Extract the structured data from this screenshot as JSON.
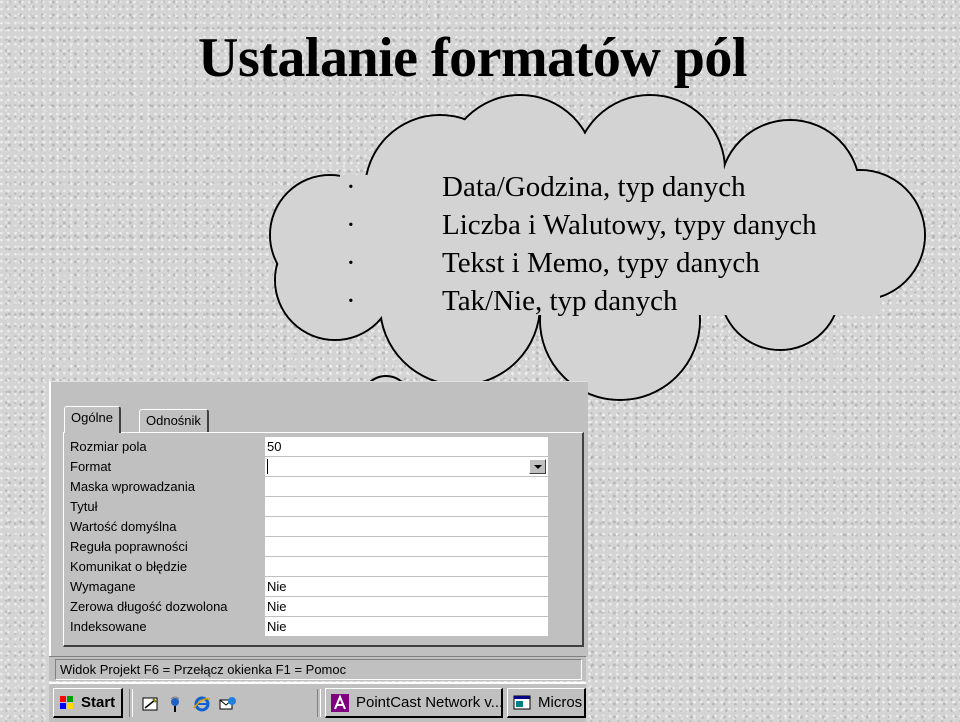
{
  "slide": {
    "title": "Ustalanie formatów pól"
  },
  "cloud": {
    "bullet": "·",
    "items": [
      "Data/Godzina, typ danych",
      "Liczba i Walutowy, typy danych",
      "Tekst i Memo, typy danych",
      "Tak/Nie, typ danych"
    ]
  },
  "properties": {
    "tabs": [
      "Ogólne",
      "Odnośnik"
    ],
    "rows": [
      {
        "label": "Rozmiar pola",
        "value": "50"
      },
      {
        "label": "Format",
        "value": ""
      },
      {
        "label": "Maska wprowadzania",
        "value": ""
      },
      {
        "label": "Tytuł",
        "value": ""
      },
      {
        "label": "Wartość domyślna",
        "value": ""
      },
      {
        "label": "Reguła poprawności",
        "value": ""
      },
      {
        "label": "Komunikat o błędzie",
        "value": ""
      },
      {
        "label": "Wymagane",
        "value": "Nie"
      },
      {
        "label": "Zerowa długość dozwolona",
        "value": "Nie"
      },
      {
        "label": "Indeksowane",
        "value": "Nie"
      }
    ]
  },
  "statusbar": {
    "text": "Widok Projekt  F6 = Przełącz okienka  F1 = Pomoc"
  },
  "taskbar": {
    "start_label": "Start",
    "tasks": [
      "PointCast Network v...",
      "Micros"
    ],
    "colors": {
      "accent": "#000080",
      "face": "#c0c0c0"
    }
  },
  "icons": [
    "windows-flag-icon",
    "desktop-icon",
    "pointcast-icon",
    "internet-explorer-icon",
    "outlook-express-icon",
    "access-icon",
    "microsoft-app-icon",
    "dropdown-arrow-icon"
  ]
}
